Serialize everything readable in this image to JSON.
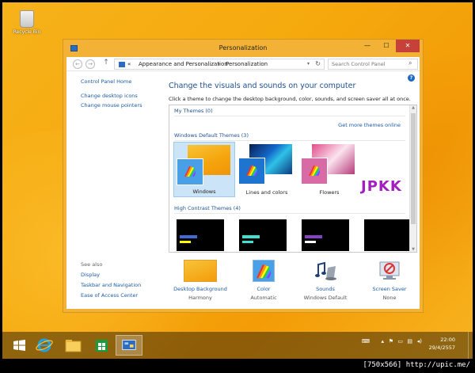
{
  "desktop": {
    "recycle_bin_label": "Recycle Bin"
  },
  "window": {
    "title": "Personalization",
    "controls": {
      "minimize": "—",
      "maximize": "☐",
      "close": "✕"
    }
  },
  "navigation": {
    "back": "←",
    "forward": "→",
    "up": "↑",
    "breadcrumbs": [
      "Appearance and Personalization",
      "Personalization"
    ],
    "chevron_root": "«",
    "chevron": "›",
    "search_placeholder": "Search Control Panel"
  },
  "sidebar": {
    "home": "Control Panel Home",
    "items": [
      "Change desktop icons",
      "Change mouse pointers"
    ],
    "see_also_header": "See also",
    "see_also": [
      "Display",
      "Taskbar and Navigation",
      "Ease of Access Center"
    ]
  },
  "main": {
    "heading": "Change the visuals and sounds on your computer",
    "subtext": "Click a theme to change the desktop background, color, sounds, and screen saver all at once.",
    "sections": {
      "my_themes": "My Themes (0)",
      "get_more": "Get more themes online",
      "default_themes": "Windows Default Themes (3)",
      "high_contrast": "High Contrast Themes (4)"
    },
    "themes": [
      {
        "name": "Windows",
        "selected": true
      },
      {
        "name": "Lines and colors",
        "selected": false
      },
      {
        "name": "Flowers",
        "selected": false
      }
    ],
    "watermark": "JPKK",
    "bottom": [
      {
        "name": "Desktop Background",
        "value": "Harmony"
      },
      {
        "name": "Color",
        "value": "Automatic"
      },
      {
        "name": "Sounds",
        "value": "Windows Default"
      },
      {
        "name": "Screen Saver",
        "value": "None"
      }
    ]
  },
  "taskbar": {
    "time": "22:00",
    "date": "29/4/2557"
  },
  "footer_caption": "[750x566] http://upic.me/",
  "colors": {
    "accent": "#f3b236",
    "link": "#1a5aa6",
    "heading": "#1e4f8f",
    "close": "#c7413b"
  }
}
